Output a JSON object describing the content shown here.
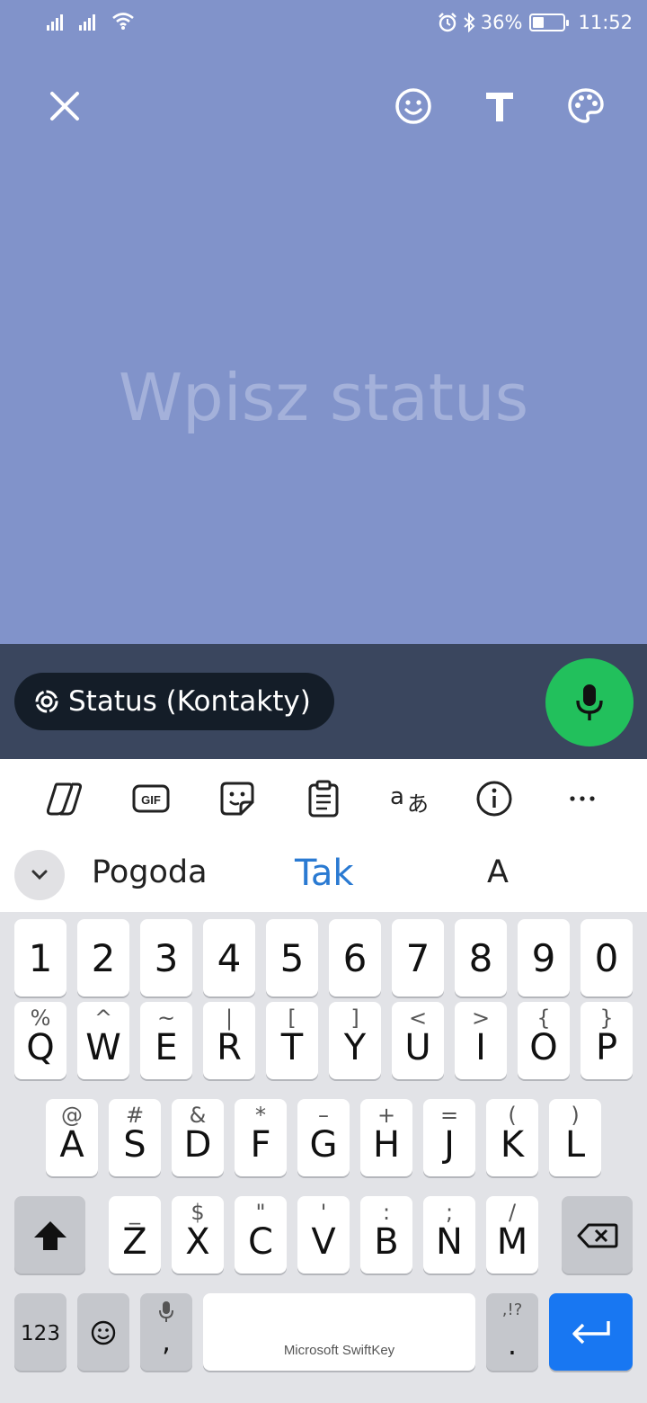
{
  "status_bar": {
    "battery_percent": "36%",
    "battery_level": 0.36,
    "time": "11:52"
  },
  "compose": {
    "placeholder": "Wpisz status",
    "background_color": "#8193ca"
  },
  "top_icons": [
    "close-icon",
    "emoji-icon",
    "text-style-icon",
    "palette-icon"
  ],
  "audience": {
    "label": "Status (Kontakty)"
  },
  "keyboard_toolbar": {
    "icons": [
      "copilot-icon",
      "gif-icon",
      "sticker-icon",
      "clipboard-icon",
      "translate-icon",
      "info-icon",
      "more-icon"
    ],
    "gif_label": "GIF"
  },
  "suggestions": {
    "items": [
      "Pogoda",
      "Tak",
      "A"
    ]
  },
  "keyboard": {
    "row_numbers": [
      "1",
      "2",
      "3",
      "4",
      "5",
      "6",
      "7",
      "8",
      "9",
      "0"
    ],
    "row1": {
      "main": [
        "Q",
        "W",
        "E",
        "R",
        "T",
        "Y",
        "U",
        "I",
        "O",
        "P"
      ],
      "secondary": [
        "%",
        "^",
        "~",
        "|",
        "[",
        "]",
        "<",
        ">",
        "{",
        "}"
      ]
    },
    "row2": {
      "main": [
        "A",
        "S",
        "D",
        "F",
        "G",
        "H",
        "J",
        "K",
        "L"
      ],
      "secondary": [
        "@",
        "#",
        "&",
        "*",
        "–",
        "+",
        "=",
        "(",
        ")"
      ]
    },
    "row3": {
      "main": [
        "Z",
        "X",
        "C",
        "V",
        "B",
        "N",
        "M"
      ],
      "secondary": [
        "_",
        "$",
        "\"",
        "'",
        ":",
        ";",
        "/"
      ]
    },
    "numbers_key": "123",
    "comma": ",",
    "period": ".",
    "period_secondary": ",!?",
    "space_label": "Microsoft SwiftKey"
  },
  "colors": {
    "accent_green": "#22c05c",
    "accent_blue": "#1877f2",
    "suggestion_blue": "#2a7ad2"
  }
}
